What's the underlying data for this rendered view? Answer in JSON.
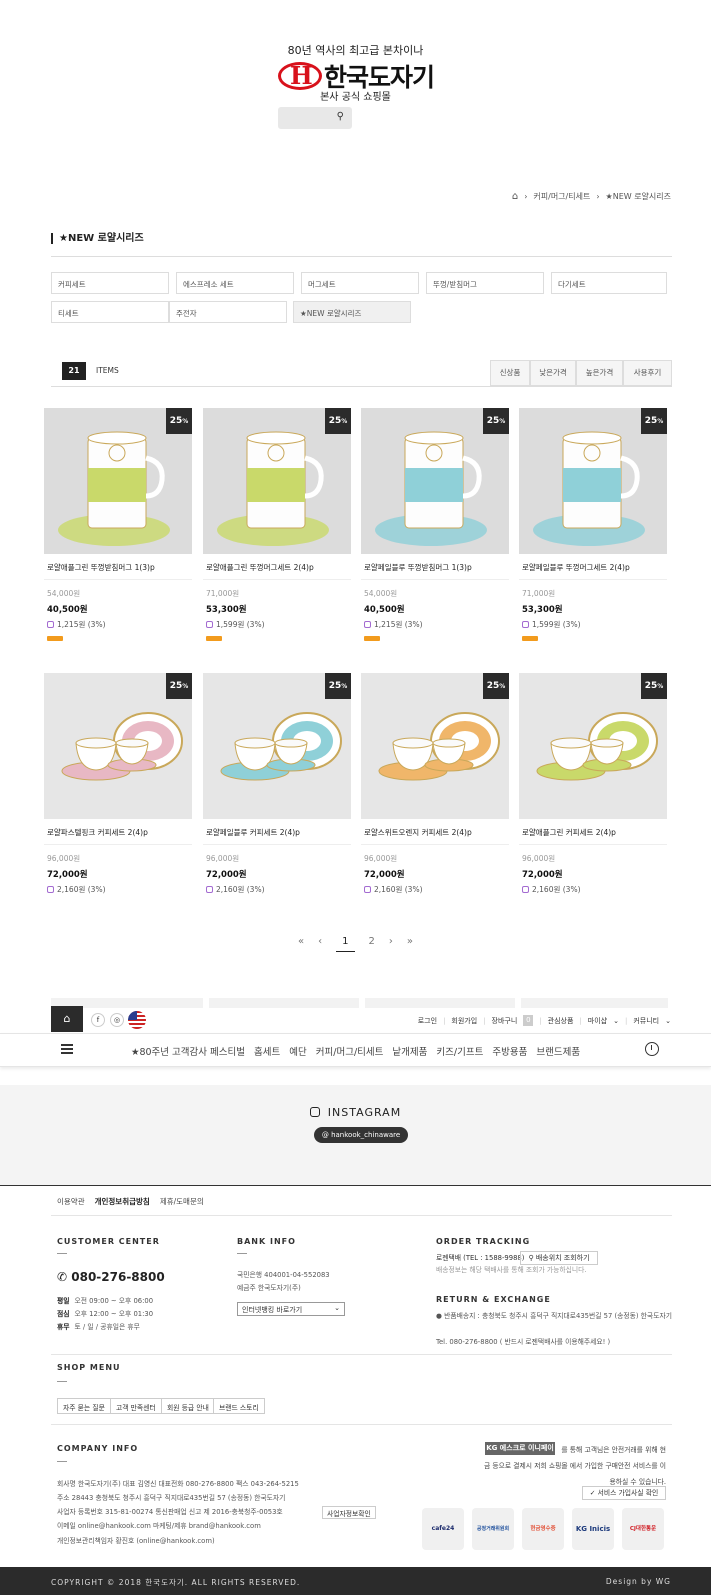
{
  "header": {
    "tagline": "80년 역사의 최고급 본차이나",
    "logo_text": "한국도자기",
    "sub_tagline": "본사 공식 쇼핑몰",
    "search_placeholder": ""
  },
  "breadcrumb": {
    "items": [
      "커피/머그/티세트",
      "★NEW 로얄시리즈"
    ]
  },
  "page_title": "★NEW 로얄시리즈",
  "categories": [
    "커피세트",
    "에스프레소 세트",
    "머그세트",
    "뚜껑/받침머그",
    "다기세트",
    "티세트",
    "주전자",
    "★NEW 로얄시리즈"
  ],
  "listing": {
    "count": "21",
    "count_label": "ITEMS",
    "sort_options": [
      "신상품",
      "낮은가격",
      "높은가격",
      "사용후기"
    ]
  },
  "products": [
    {
      "name": "로얄애플그린 뚜껑받침머그 1(3)p",
      "orig": "54,000원",
      "sale": "40,500원",
      "mileage": "1,215원 (3%)",
      "discount": "25",
      "discount_unit": "%",
      "is_new": true,
      "color": "#c9d96a"
    },
    {
      "name": "로얄애플그린 뚜껑머그세트 2(4)p",
      "orig": "71,000원",
      "sale": "53,300원",
      "mileage": "1,599원 (3%)",
      "discount": "25",
      "discount_unit": "%",
      "is_new": true,
      "color": "#c9d96a"
    },
    {
      "name": "로얄페일블루 뚜껑받침머그 1(3)p",
      "orig": "54,000원",
      "sale": "40,500원",
      "mileage": "1,215원 (3%)",
      "discount": "25",
      "discount_unit": "%",
      "is_new": true,
      "color": "#8fd0d8"
    },
    {
      "name": "로얄페일블루 뚜껑머그세트 2(4)p",
      "orig": "71,000원",
      "sale": "53,300원",
      "mileage": "1,599원 (3%)",
      "discount": "25",
      "discount_unit": "%",
      "is_new": true,
      "color": "#8fd0d8"
    },
    {
      "name": "로얄파스텔핑크 커피세트 2(4)p",
      "orig": "96,000원",
      "sale": "72,000원",
      "mileage": "2,160원 (3%)",
      "discount": "25",
      "discount_unit": "%",
      "is_new": false,
      "color": "#e8b8c4"
    },
    {
      "name": "로얄페일블루 커피세트 2(4)p",
      "orig": "96,000원",
      "sale": "72,000원",
      "mileage": "2,160원 (3%)",
      "discount": "25",
      "discount_unit": "%",
      "is_new": false,
      "color": "#8fd0d8"
    },
    {
      "name": "로얄스위트오렌지 커피세트 2(4)p",
      "orig": "96,000원",
      "sale": "72,000원",
      "mileage": "2,160원 (3%)",
      "discount": "25",
      "discount_unit": "%",
      "is_new": false,
      "color": "#f0b66a"
    },
    {
      "name": "로얄애플그린 커피세트 2(4)p",
      "orig": "96,000원",
      "sale": "72,000원",
      "mileage": "2,160원 (3%)",
      "discount": "25",
      "discount_unit": "%",
      "is_new": false,
      "color": "#c9d96a"
    }
  ],
  "pagination": {
    "current": "1",
    "next_page": "2",
    "first": "«",
    "prev": "‹",
    "next": "›",
    "last": "»"
  },
  "topbar": {
    "social": [
      "f",
      "◎"
    ],
    "links": [
      "로그인",
      "회원가입",
      "장바구니",
      "관심상품",
      "마이샵",
      "커뮤니티"
    ],
    "cart_count": "0"
  },
  "nav": {
    "items": [
      "★80주년 고객감사 페스티벌",
      "홈세트",
      "예단",
      "커피/머그/티세트",
      "낱개제품",
      "키즈/기프트",
      "주방용품",
      "브랜드제품"
    ]
  },
  "instagram": {
    "title": "INSTAGRAM",
    "handle": "@ hankook_chinaware"
  },
  "footer": {
    "links": [
      "이용약관",
      "개인정보취급방침",
      "제휴/도매문의"
    ],
    "customer_center": {
      "title": "CUSTOMER CENTER",
      "phone": "080-276-8800",
      "hours": [
        {
          "label": "평일",
          "value": "오전 09:00 ~ 오후 06:00"
        },
        {
          "label": "점심",
          "value": "오후 12:00 ~ 오후 01:30"
        },
        {
          "label": "휴무",
          "value": "토 / 일 / 공휴일은 휴무"
        }
      ]
    },
    "bank_info": {
      "title": "BANK INFO",
      "account": "국민은행 404001-04-552083",
      "holder": "예금주 한국도자기(주)",
      "select_label": "인터넷뱅킹 바로가기"
    },
    "order_tracking": {
      "title": "ORDER TRACKING",
      "courier": "로젠택배 (TEL : 1588-9988)",
      "track_button": "배송위치 조회하기",
      "note": "배송정보는 해당 택배사를 통해 조회가 가능하십니다."
    },
    "return_exchange": {
      "title": "RETURN & EXCHANGE",
      "address": "반품배송지 : 충청북도 청주시 흥덕구 직지대로435번길 57 (송정동) 한국도자기",
      "tel": "Tel. 080-276-8800 ( 반드시 로젠택배사를 이용해주세요! )"
    },
    "shop_menu": {
      "title": "SHOP MENU",
      "buttons": [
        "자주 묻는 질문",
        "고객 만족센터",
        "회원 등급 안내",
        "브랜드 스토리"
      ]
    },
    "company_info": {
      "title": "COMPANY INFO",
      "rows": [
        "회사명 한국도자기(주)  대표 김영신  대표전화 080-276-8800  팩스 043-264-5215",
        "주소  28443 충청북도 청주시 흥덕구 직지대로435번길 57 (송정동) 한국도자기",
        "사업자 등록번호 315-81-00274  통신판매업 신고 제 2016-충북청주-0053호",
        "이메일  online@hankook.com  마케팅/제휴  brand@hankook.com",
        "개인정보관리책임자 황진호 (online@hankook.com)"
      ],
      "biz_button": "사업자정보확인"
    },
    "escrow": {
      "badge": "KG 에스크로 이니페이",
      "text1": "를 통해 고객님은 안전거래를 위해 현",
      "text2": "금 등으로 결제시 저희 쇼핑몰 에서 가입한 구매안전 서비스를 이",
      "text3": "용하실 수 있습니다.",
      "button": "서비스 가입사실 확인"
    },
    "partners": [
      {
        "label": "cafe24",
        "color": "#1b2a6b"
      },
      {
        "label": "공정거래위원회",
        "color": "#1e4f9c"
      },
      {
        "label": "현금영수증",
        "color": "#e2533a"
      },
      {
        "label": "KG Inicis",
        "color": "#1d3a7c"
      },
      {
        "label": "CJ대한통운",
        "color": "#d12027"
      }
    ],
    "copyright": "COPYRIGHT © 2018 한국도자기. ALL RIGHTS RESERVED.",
    "design": "Design by WG"
  }
}
